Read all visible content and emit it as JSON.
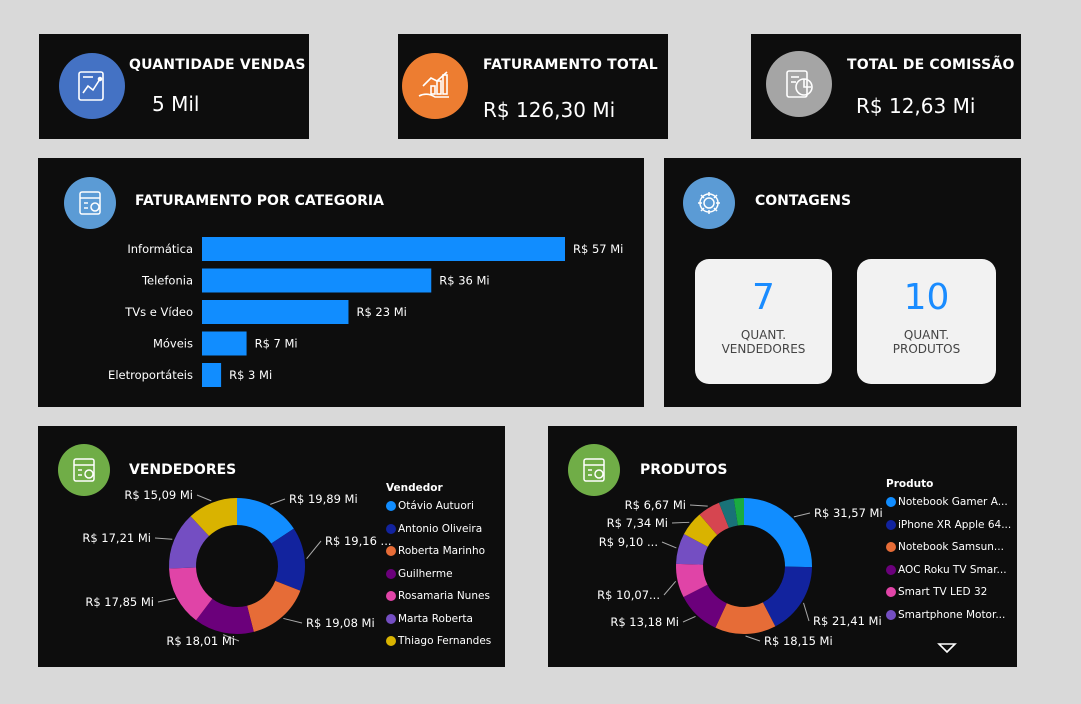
{
  "kpis": {
    "vendas": {
      "title": "QUANTIDADE VENDAS",
      "value": "5 Mil",
      "icon": "sales-report-icon",
      "color": "#4472c4"
    },
    "faturamento": {
      "title": "FATURAMENTO TOTAL",
      "value": "R$ 126,30 Mi",
      "icon": "revenue-growth-icon",
      "color": "#ed7d31"
    },
    "comissao": {
      "title": "TOTAL DE COMISSÃO",
      "value": "R$ 12,63 Mi",
      "icon": "commission-report-icon",
      "color": "#a5a5a5"
    }
  },
  "categoria": {
    "title": "FATURAMENTO POR CATEGORIA",
    "icon": "calculator-icon",
    "color": "#5b9bd5"
  },
  "contagens": {
    "title": "CONTAGENS",
    "icon": "gear-icon",
    "color": "#5b9bd5",
    "vendedores": {
      "value": "7",
      "label1": "QUANT.",
      "label2": "VENDEDORES"
    },
    "produtos": {
      "value": "10",
      "label1": "QUANT.",
      "label2": "PRODUTOS"
    }
  },
  "vendedores": {
    "title": "VENDEDORES",
    "icon": "calculator-icon",
    "color": "#70ad47",
    "legend_title": "Vendedor"
  },
  "produtos": {
    "title": "PRODUTOS",
    "icon": "calculator-icon",
    "color": "#70ad47",
    "legend_title": "Produto",
    "more_icon": "triangle-down-icon"
  },
  "chart_data": [
    {
      "type": "bar",
      "orientation": "horizontal",
      "categories": [
        "Informática",
        "Telefonia",
        "TVs e Vídeo",
        "Móveis",
        "Eletroportáteis"
      ],
      "values": [
        57,
        36,
        23,
        7,
        3
      ],
      "data_labels": [
        "R$ 57 Mi",
        "R$ 36 Mi",
        "R$ 23 Mi",
        "R$ 7 Mi",
        "R$ 3 Mi"
      ],
      "color": "#118dff"
    },
    {
      "type": "pie",
      "donut": true,
      "categories": [
        "Otávio Autuori",
        "Antonio Oliveira",
        "Roberta Marinho",
        "Guilherme",
        "Rosamaria Nunes",
        "Marta Roberta",
        "Thiago Fernandes"
      ],
      "values": [
        19.89,
        19.16,
        19.08,
        18.01,
        17.85,
        17.21,
        15.09
      ],
      "data_labels": [
        "R$ 19,89 Mi",
        "R$ 19,16 ...",
        "R$ 19,08 Mi",
        "R$ 18,01 Mi",
        "R$ 17,85 Mi",
        "R$ 17,21 Mi",
        "R$ 15,09 Mi"
      ],
      "colors": [
        "#118dff",
        "#12239e",
        "#e66c37",
        "#6b007b",
        "#e044a7",
        "#744ec2",
        "#d9b300"
      ]
    },
    {
      "type": "pie",
      "donut": true,
      "categories": [
        "Notebook Gamer A...",
        "iPhone XR Apple 64...",
        "Notebook Samsun...",
        "AOC Roku TV Smar...",
        "Smart TV LED 32",
        "Smartphone Motor...",
        "",
        "",
        "",
        ""
      ],
      "values": [
        31.57,
        21.41,
        18.15,
        13.18,
        10.07,
        9.1,
        7.34,
        6.67,
        4.5,
        3.0
      ],
      "data_labels": [
        "R$ 31,57 Mi",
        "R$ 21,41 Mi",
        "R$ 18,15 Mi",
        "R$ 13,18 Mi",
        "R$ 10,07...",
        "R$ 9,10 ...",
        "R$ 7,34 Mi",
        "R$ 6,67 Mi",
        "",
        ""
      ],
      "colors": [
        "#118dff",
        "#12239e",
        "#e66c37",
        "#6b007b",
        "#e044a7",
        "#744ec2",
        "#d9b300",
        "#d64550",
        "#197278",
        "#1aab40"
      ]
    }
  ]
}
